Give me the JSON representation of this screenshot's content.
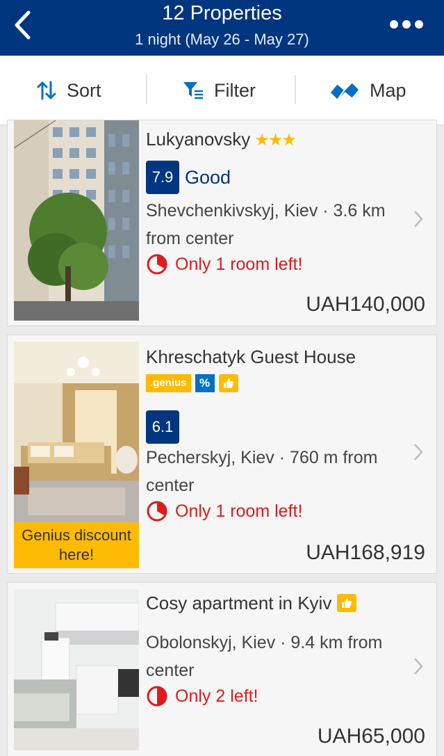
{
  "header": {
    "title": "12 Properties",
    "subtitle": "1 night (May 26 - May 27)"
  },
  "toolbar": {
    "sort_label": "Sort",
    "filter_label": "Filter",
    "map_label": "Map"
  },
  "colors": {
    "brand_blue": "#003580",
    "accent_yellow": "#febb02",
    "urgency_red": "#e01b1b",
    "percent_blue": "#0071c2"
  },
  "icons": [
    "back-arrow-icon",
    "more-dots-icon",
    "sort-icon",
    "filter-icon",
    "map-icon",
    "stars-icon",
    "clock-icon",
    "thumbs-up-icon",
    "chevron-right-icon"
  ],
  "properties": [
    {
      "name": "Lukyanovsky",
      "stars": "★★★",
      "score": "7.9",
      "score_word": "Good",
      "location": "Shevchenkivskyj, Kiev · 3.6 km from center",
      "urgency": "Only 1 room left!",
      "price": "UAH140,000"
    },
    {
      "name": "Khreschatyk Guest House",
      "badge_genius": ".genius",
      "badge_percent": "%",
      "score": "6.1",
      "location": "Pecherskyj, Kiev · 760 m from center",
      "urgency": "Only 1 room left!",
      "price": "UAH168,919",
      "genius_banner": "Genius discount here!"
    },
    {
      "name": "Cosy apartment in Kyiv",
      "location": "Obolonskyj, Kiev · 9.4 km from center",
      "urgency": "Only 2 left!",
      "price": "UAH65,000"
    }
  ]
}
